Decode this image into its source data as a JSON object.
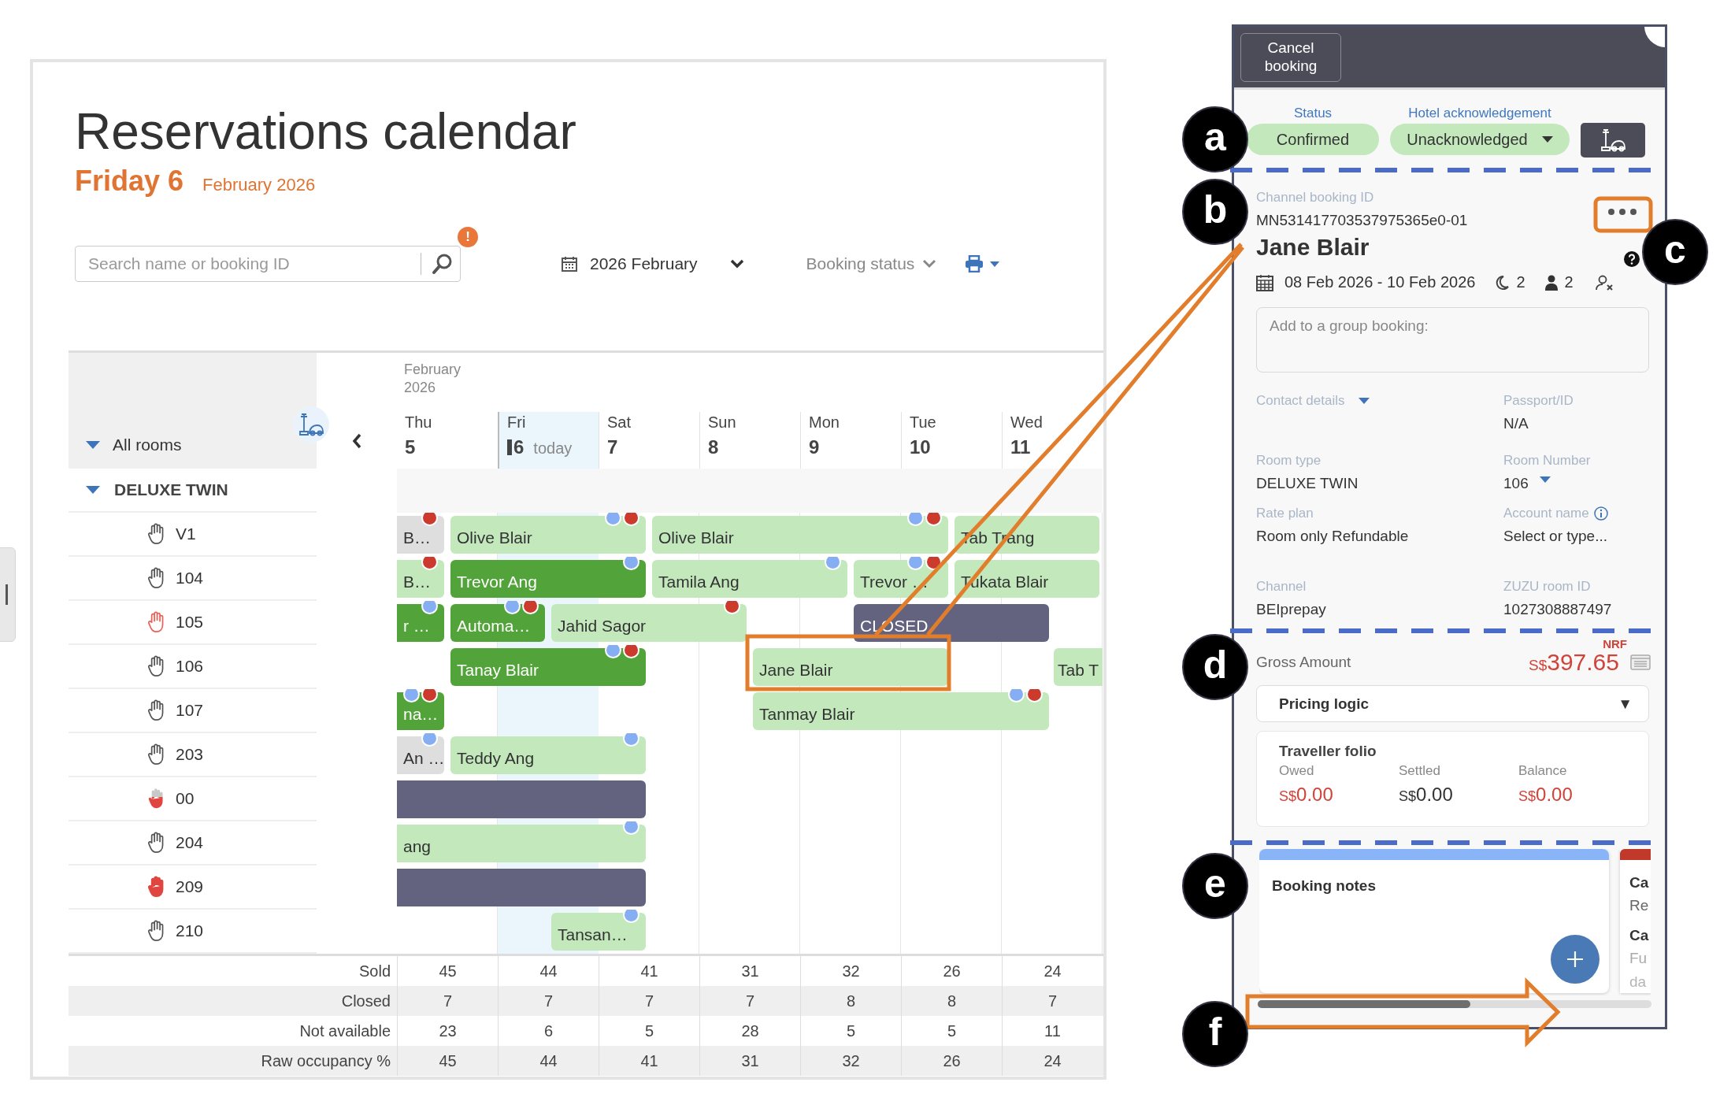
{
  "page": {
    "title": "Reservations calendar",
    "day": "Friday 6",
    "month": "February 2026"
  },
  "toolbar": {
    "search": {
      "placeholder": "Search name or booking ID",
      "alert": "!"
    },
    "month_picker": "2026 February",
    "booking_status": "Booking status"
  },
  "calendar": {
    "period": "February 2026",
    "all_rooms": "All rooms",
    "room_type": "DELUXE TWIN",
    "days": [
      {
        "name": "Thu",
        "number": "5",
        "selected": false
      },
      {
        "name": "Fri",
        "number": "6",
        "today": "today",
        "selected": true
      },
      {
        "name": "Sat",
        "number": "7",
        "selected": false
      },
      {
        "name": "Sun",
        "number": "8",
        "selected": false
      },
      {
        "name": "Mon",
        "number": "9",
        "selected": false
      },
      {
        "name": "Tue",
        "number": "10",
        "selected": false
      },
      {
        "name": "Wed",
        "number": "11",
        "selected": false
      }
    ],
    "rooms": [
      {
        "name": "V1",
        "kind": "outline",
        "bookings": [
          {
            "guest": "B…",
            "kind": "gray",
            "dots": [
              {
                "color": "#cc3a2e"
              }
            ]
          },
          {
            "guest": "Olive Blair",
            "kind": "light",
            "dots": [
              {
                "color": "#86aef2"
              },
              {
                "color": "#cc3a2e"
              }
            ]
          },
          {
            "guest": "Olive Blair",
            "kind": "light",
            "dots": [
              {
                "color": "#86aef2"
              },
              {
                "color": "#cc3a2e"
              }
            ]
          },
          {
            "guest": "Tab Trang",
            "kind": "light"
          }
        ]
      },
      {
        "name": "104",
        "kind": "outline",
        "bookings": [
          {
            "guest": "B…",
            "kind": "light",
            "dots": [
              {
                "color": "#cc3a2e"
              }
            ]
          },
          {
            "guest": "Trevor Ang",
            "kind": "dark",
            "dots": [
              {
                "color": "#86aef2"
              }
            ]
          },
          {
            "guest": "Tamila Ang",
            "kind": "light",
            "dots": [
              {
                "color": "#86aef2"
              }
            ]
          },
          {
            "guest": "Trevor …",
            "kind": "light",
            "dots": [
              {
                "color": "#86aef2"
              },
              {
                "color": "#cc3a2e"
              }
            ]
          },
          {
            "guest": "Tukata Blair",
            "kind": "light"
          }
        ]
      },
      {
        "name": "105",
        "kind": "red_outline",
        "bookings": [
          {
            "guest": "r …",
            "kind": "dark",
            "dots": [
              {
                "color": "#86aef2"
              }
            ]
          },
          {
            "guest": "Automa…",
            "kind": "dark",
            "dots": [
              {
                "color": "#86aef2"
              },
              {
                "color": "#cc3a2e"
              }
            ]
          },
          {
            "guest": "Jahid Sagor",
            "kind": "light",
            "dots": [
              {
                "color": "#cc3a2e"
              }
            ]
          },
          {
            "guest": "CLOSED",
            "kind": "closed"
          }
        ]
      },
      {
        "name": "106",
        "kind": "outline",
        "bookings": [
          {
            "guest": "Tanay Blair",
            "kind": "dark",
            "dots": [
              {
                "color": "#86aef2"
              },
              {
                "color": "#cc3a2e"
              }
            ]
          },
          {
            "guest": "Jane Blair",
            "kind": "light"
          },
          {
            "guest": "Tab T",
            "kind": "light"
          }
        ]
      },
      {
        "name": "107",
        "kind": "outline",
        "bookings": [
          {
            "guest": "na…",
            "kind": "dark",
            "dots": [
              {
                "color": "#86aef2"
              },
              {
                "color": "#cc3a2e"
              }
            ]
          },
          {
            "guest": "Tanmay Blair",
            "kind": "light",
            "dots": [
              {
                "color": "#86aef2"
              },
              {
                "color": "#cc3a2e"
              }
            ]
          }
        ]
      },
      {
        "name": "203",
        "kind": "outline",
        "bookings": [
          {
            "guest": "An …",
            "kind": "gray",
            "dots": [
              {
                "color": "#86aef2"
              }
            ]
          },
          {
            "guest": "Teddy Ang",
            "kind": "light",
            "dots": [
              {
                "color": "#86aef2"
              }
            ]
          }
        ]
      },
      {
        "name": "00",
        "kind": "half_red",
        "bookings": [
          {
            "kind": "closed"
          }
        ]
      },
      {
        "name": "204",
        "kind": "outline",
        "bookings": [
          {
            "guest": "ang",
            "kind": "light",
            "dots": [
              {
                "color": "#86aef2"
              }
            ]
          }
        ]
      },
      {
        "name": "209",
        "kind": "red",
        "bookings": [
          {
            "kind": "closed"
          }
        ]
      },
      {
        "name": "210",
        "kind": "outline",
        "bookings": [
          {
            "guest": "Tansan…",
            "kind": "light",
            "dots": [
              {
                "color": "#86aef2"
              }
            ]
          }
        ]
      }
    ],
    "summary": [
      {
        "label": "Sold",
        "values": [
          "45",
          "44",
          "41",
          "31",
          "32",
          "26",
          "24"
        ]
      },
      {
        "label": "Closed",
        "values": [
          "7",
          "7",
          "7",
          "7",
          "8",
          "8",
          "7"
        ]
      },
      {
        "label": "Not available",
        "values": [
          "23",
          "6",
          "5",
          "28",
          "5",
          "5",
          "11"
        ]
      },
      {
        "label": "Raw occupancy %",
        "values": [
          "45",
          "44",
          "41",
          "31",
          "32",
          "26",
          "24"
        ]
      }
    ]
  },
  "booking_panel": {
    "cancel_button": "Cancel booking",
    "status": {
      "label": "Status",
      "value": "Confirmed"
    },
    "acknowledgement": {
      "label": "Hotel acknowledgement",
      "value": "Unacknowledged"
    },
    "channel_booking_id": {
      "label": "Channel booking ID",
      "value": "MN531417703537975365e0-01"
    },
    "guest": "Jane Blair",
    "dates": "08 Feb 2026 - 10 Feb 2026",
    "nights": "2",
    "guests": "2",
    "group_booking": {
      "placeholder": "Add to a group booking:"
    },
    "fields": [
      {
        "label": "Contact details",
        "kind": "toggle"
      },
      {
        "label": "Passport/ID",
        "value": "N/A",
        "kind": "text"
      },
      {
        "label": "Room type",
        "value": "DELUXE TWIN",
        "kind": "text"
      },
      {
        "label": "Room Number",
        "value": "106",
        "kind": "select"
      },
      {
        "label": "Rate plan",
        "value": "Room only Refundable",
        "kind": "text"
      },
      {
        "label": "Account name",
        "value": "Select or type...",
        "kind": "info"
      },
      {
        "label": "Channel",
        "value": "BEIprepay",
        "kind": "text"
      },
      {
        "label": "ZUZU room ID",
        "value": "1027308887497",
        "kind": "text"
      }
    ],
    "gross": {
      "tag": "NRF",
      "label": "Gross Amount",
      "currency": "S$",
      "amount": "397.65"
    },
    "pricing_logic": {
      "label": "Pricing logic",
      "caret": "▼"
    },
    "folio": {
      "title": "Traveller folio",
      "columns": [
        {
          "label": "Owed",
          "currency": "S$",
          "amount": "0.00",
          "color": "#d0433a"
        },
        {
          "label": "Settled",
          "currency": "S$",
          "amount": "0.00",
          "color": "#333333"
        },
        {
          "label": "Balance",
          "currency": "S$",
          "amount": "0.00",
          "color": "#d0433a"
        }
      ]
    },
    "notes": {
      "title": "Booking notes"
    },
    "next_card": [
      {
        "text": "Ca",
        "kind": "heading"
      },
      {
        "text": "Re",
        "kind": "body"
      },
      {
        "text": "Ca",
        "kind": "heading"
      },
      {
        "text": "Fu",
        "kind": "muted"
      },
      {
        "text": "da",
        "kind": "faint"
      }
    ]
  },
  "annotations": {
    "callouts": [
      "a",
      "b",
      "c",
      "d",
      "e",
      "f"
    ]
  }
}
